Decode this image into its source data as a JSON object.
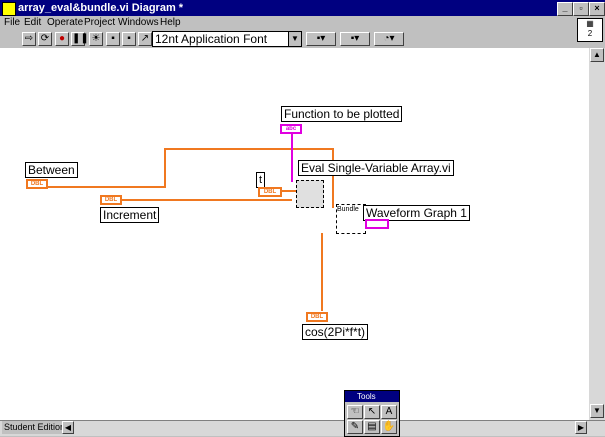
{
  "window": {
    "title": "array_eval&bundle.vi Diagram *"
  },
  "menu": [
    "File",
    "Edit",
    "Operate",
    "Project",
    "Windows",
    "Help"
  ],
  "toolbar": {
    "font": "12nt Application Font"
  },
  "vi_icon_label": "2",
  "diagram": {
    "labels": {
      "function": "Function to be plotted",
      "between": "Between",
      "increment": "Increment",
      "eval": "Eval Single-Variable Array.vi",
      "graph": "Waveform Graph 1",
      "cos": "cos(2Pi*f*t)",
      "bundle": "Bundle",
      "t": "t"
    },
    "terminals": {
      "dbl": "DBL",
      "abc": "abc"
    }
  },
  "status": "Student Edition",
  "tools_palette": {
    "title": "Tools"
  }
}
